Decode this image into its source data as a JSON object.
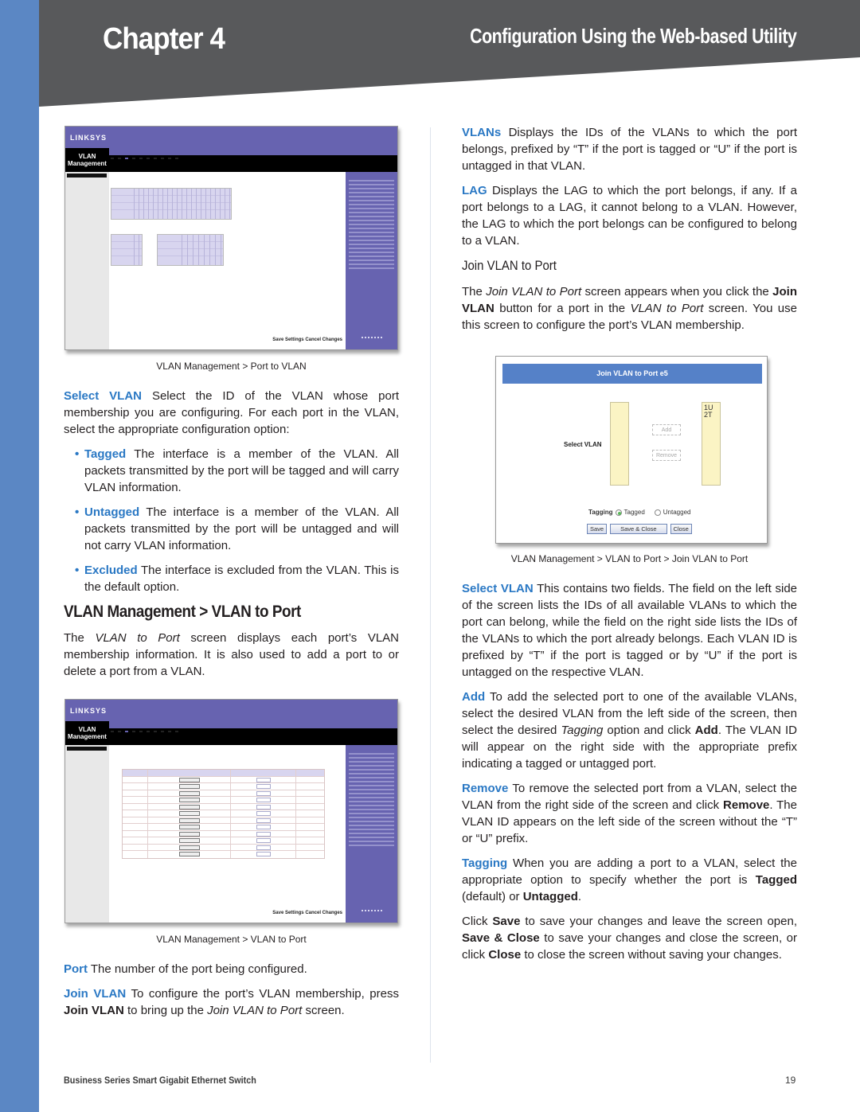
{
  "header": {
    "chapter": "Chapter 4",
    "section": "Configuration Using the Web-based Utility"
  },
  "left_column": {
    "figure1": {
      "app_brand": "LINKSYS",
      "section_label": "VLAN Management",
      "caption": "VLAN Management > Port to VLAN",
      "save_settings": "Save Settings",
      "cancel_changes": "Cancel Changes"
    },
    "select_vlan": {
      "term": "Select VLAN",
      "text": " Select the ID of the VLAN whose port membership you are configuring. For each port in the VLAN, select the appropriate configuration option:"
    },
    "bullets": [
      {
        "term": "Tagged",
        "text": "  The interface is a member of the VLAN. All packets transmitted by the port will be tagged and will carry VLAN information."
      },
      {
        "term": "Untagged",
        "text": "  The interface is a member of the VLAN. All packets transmitted by the port will be untagged and will not carry VLAN information."
      },
      {
        "term": "Excluded",
        "text": "  The interface is excluded from the VLAN. This is the default option."
      }
    ],
    "heading": "VLAN Management > VLAN to Port",
    "intro": {
      "t1": "The ",
      "i1": "VLAN to Port",
      "t2": " screen displays each port’s VLAN membership information. It is also used to add a port to or delete a port from a VLAN."
    },
    "figure2": {
      "app_brand": "LINKSYS",
      "section_label": "VLAN Management",
      "caption": "VLAN Management > VLAN to Port",
      "save_settings": "Save Settings",
      "cancel_changes": "Cancel Changes"
    },
    "port": {
      "term": "Port",
      "text": "  The number of the port being configured."
    },
    "join_vlan": {
      "term": "Join VLAN",
      "t1": "  To configure the port’s VLAN membership, press ",
      "b1": "Join VLAN",
      "t2": " to bring up the ",
      "i1": "Join VLAN to Port",
      "t3": " screen."
    }
  },
  "right_column": {
    "vlans": {
      "term": "VLANs",
      "text": "  Displays the IDs of the VLANs to which the port belongs, prefixed by “T” if the port is tagged or “U” if the port is untagged in that VLAN."
    },
    "lag": {
      "term": "LAG",
      "text": "   Displays the LAG to which the port belongs, if any. If a port belongs to a LAG, it cannot belong to a VLAN. However, the LAG to which the port belongs can be configured to belong to a VLAN."
    },
    "subheading": "Join VLAN to Port",
    "join_intro": {
      "t1": "The ",
      "i1": "Join VLAN to Port",
      "t2": " screen appears when you click the ",
      "b1": "Join VLAN",
      "t3": " button for a port in the ",
      "i2": "VLAN to Port",
      "t4": " screen. You use this screen to configure the port’s VLAN membership."
    },
    "dialog": {
      "title": "Join VLAN to Port e5",
      "select_label": "Select VLAN",
      "right_list": [
        "1U",
        "2T"
      ],
      "add": "Add",
      "remove": "Remove",
      "tagging_label": "Tagging",
      "tagged": "Tagged",
      "untagged": "Untagged",
      "selected_tagging": "Tagged",
      "save": "Save",
      "save_close": "Save & Close",
      "close": "Close",
      "caption": "VLAN Management > VLAN to Port > Join VLAN to Port"
    },
    "select_vlan": {
      "term": "Select VLAN",
      "text": "  This contains two fields. The field on the left side of the screen lists the IDs of all available VLANs to which the port can belong, while the field on the right side lists the IDs of the VLANs to which the port already belongs. Each VLAN ID is prefixed by “T” if the port is tagged or by “U” if the port is untagged on the respective VLAN."
    },
    "add": {
      "term": "Add",
      "t1": "  To add the selected port to one of the available VLANs, select the desired VLAN from the left side of the screen, then select the desired ",
      "i1": "Tagging",
      "t2": " option and click ",
      "b1": "Add",
      "t3": ". The VLAN ID will appear on the right side with the appropriate prefix indicating a tagged or untagged port."
    },
    "remove": {
      "term": "Remove",
      "t1": "  To remove the selected port from a VLAN, select the VLAN from the right side of the screen and click ",
      "b1": "Remove",
      "t2": ". The VLAN ID appears on the left side of the screen without the “T” or “U” prefix."
    },
    "tagging": {
      "term": "Tagging",
      "t1": "  When you are adding a port to a VLAN, select the appropriate option to specify whether the port is ",
      "b1": "Tagged",
      "t2": " (default) or ",
      "b2": "Untagged",
      "t3": "."
    },
    "click_save": {
      "t1": "Click ",
      "b1": "Save",
      "t2": " to save your changes and leave the screen open, ",
      "b2": "Save & Close",
      "t3": " to save your changes and close the screen, or click ",
      "b3": "Close",
      "t4": " to close the screen without saving your changes."
    }
  },
  "footer": {
    "product": "Business Series Smart Gigabit Ethernet Switch",
    "page_number": "19"
  },
  "colors": {
    "accent_blue": "#2a78c4",
    "sidebar_blue": "#5b87c4",
    "header_gray": "#58595b",
    "linksys_purple": "#6763b0"
  }
}
